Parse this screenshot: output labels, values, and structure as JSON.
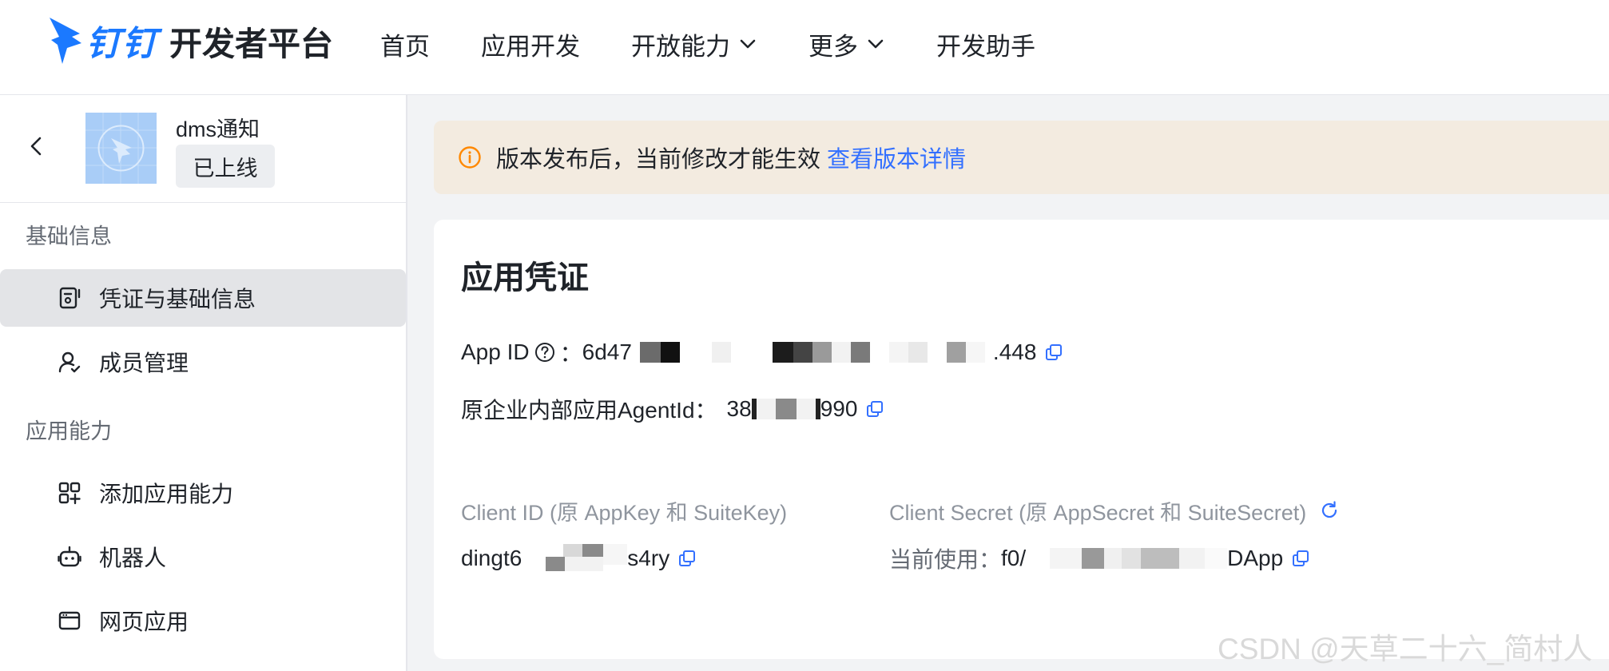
{
  "header": {
    "logo_ding": "钉钉",
    "logo_title": "开发者平台",
    "nav": [
      {
        "label": "首页",
        "dropdown": false
      },
      {
        "label": "应用开发",
        "dropdown": false
      },
      {
        "label": "开放能力",
        "dropdown": true
      },
      {
        "label": "更多",
        "dropdown": true
      },
      {
        "label": "开发助手",
        "dropdown": false
      }
    ]
  },
  "sidebar": {
    "app_name": "dms通知",
    "app_status": "已上线",
    "groups": [
      {
        "title": "基础信息",
        "items": [
          {
            "label": "凭证与基础信息",
            "icon": "credential-icon",
            "active": true
          },
          {
            "label": "成员管理",
            "icon": "member-icon",
            "active": false
          }
        ]
      },
      {
        "title": "应用能力",
        "items": [
          {
            "label": "添加应用能力",
            "icon": "add-capability-icon",
            "active": false
          },
          {
            "label": "机器人",
            "icon": "robot-icon",
            "active": false
          },
          {
            "label": "网页应用",
            "icon": "web-app-icon",
            "active": false
          }
        ]
      }
    ]
  },
  "notice": {
    "text": "版本发布后，当前修改才能生效",
    "link": "查看版本详情"
  },
  "credentials": {
    "title": "应用凭证",
    "app_id_label": "App ID",
    "app_id_colon": "：",
    "app_id_prefix": "6d47",
    "app_id_suffix": ".448",
    "agent_id_label": "原企业内部应用AgentId：",
    "agent_id_prefix": "38",
    "agent_id_suffix": "990",
    "client_id_label": "Client ID (原 AppKey 和 SuiteKey)",
    "client_id_prefix": "dingt6",
    "client_id_suffix": "s4ry",
    "client_secret_label": "Client Secret (原 AppSecret 和 SuiteSecret)",
    "client_secret_current": "当前使用：",
    "client_secret_prefix": "f0/",
    "client_secret_suffix": "DApp"
  },
  "watermark": "CSDN @天草二十六_简村人",
  "colors": {
    "accent": "#3370ff",
    "brand": "#1b79ff",
    "notice_bg": "#f3ebe0",
    "warning": "#ff8800"
  }
}
